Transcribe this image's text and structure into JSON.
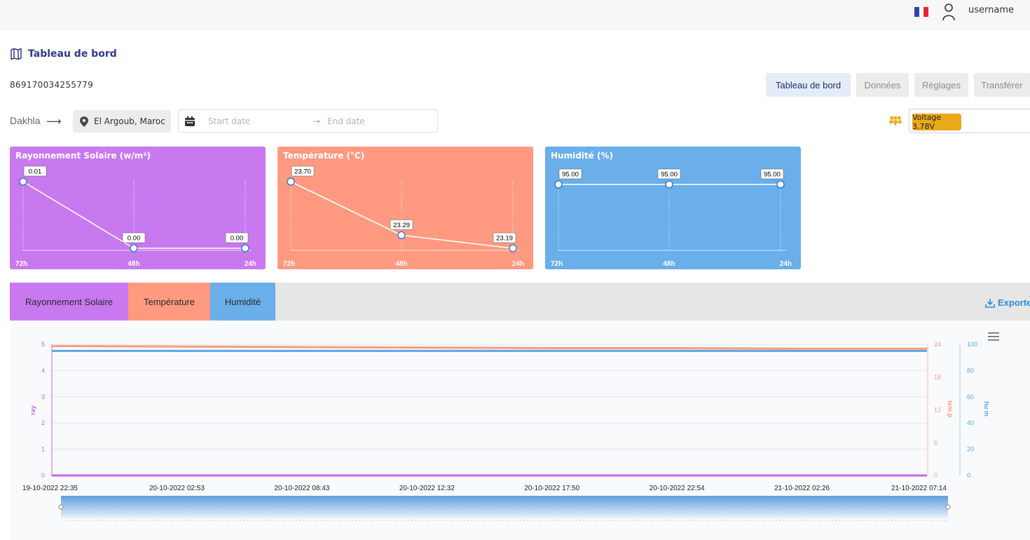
{
  "header": {
    "username": "username",
    "language_flag": "fr-flag-icon",
    "flag_colors": [
      "#2d46a8",
      "#ffffff",
      "#e32631"
    ]
  },
  "page": {
    "title": "Tableau de bord",
    "title_icon": "map-icon",
    "device_id": "869170034255779"
  },
  "nav_tabs": [
    {
      "label": "Tableau de bord",
      "active": true
    },
    {
      "label": "Données",
      "active": false
    },
    {
      "label": "Réglages",
      "active": false
    },
    {
      "label": "Transférer",
      "active": false
    }
  ],
  "location": {
    "from": "Dakhla",
    "arrow": "⟶",
    "to": "El Argoub, Maroc",
    "to_icon": "location-pin-icon"
  },
  "date_range": {
    "start_placeholder": "Start date",
    "separator": "→",
    "end_placeholder": "End date",
    "icon": "calendar-icon"
  },
  "voltage": {
    "icon": "solar-panel-icon",
    "label": "Voltage 3.78V",
    "badge_color": "#e9a91a"
  },
  "mini_cards": [
    {
      "title": "Rayonnement Solaire (w/m²)",
      "color": "#c879ef",
      "points": [
        {
          "label": "72h",
          "value": "0.01",
          "y": 0.01
        },
        {
          "label": "48h",
          "value": "0.00",
          "y": 0.0
        },
        {
          "label": "24h",
          "value": "0.00",
          "y": 0.0
        }
      ]
    },
    {
      "title": "Température (°C)",
      "color": "#ff9a80",
      "points": [
        {
          "label": "72h",
          "value": "23.70",
          "y": 23.7
        },
        {
          "label": "48h",
          "value": "23.29",
          "y": 23.29
        },
        {
          "label": "24h",
          "value": "23.19",
          "y": 23.19
        }
      ]
    },
    {
      "title": "Humidité (%)",
      "color": "#6aaeea",
      "points": [
        {
          "label": "72h",
          "value": "95.00",
          "y": 95.0
        },
        {
          "label": "48h",
          "value": "95.00",
          "y": 95.0
        },
        {
          "label": "24h",
          "value": "95.00",
          "y": 95.0
        }
      ]
    }
  ],
  "chart_tabs": [
    {
      "label": "Rayonnement Solaire",
      "color": "#c879ef"
    },
    {
      "label": "Température",
      "color": "#ff9a80"
    },
    {
      "label": "Humidité",
      "color": "#6aaeea"
    }
  ],
  "export": {
    "label": "Exporter",
    "icon": "download-icon"
  },
  "chart_data": {
    "type": "line",
    "x": [
      "19-10-2022 22:35",
      "20-10-2022 02:53",
      "20-10-2022 08:43",
      "20-10-2022 12:32",
      "20-10-2022 17:50",
      "20-10-2022 22:54",
      "21-10-2022 02:26",
      "21-10-2022 07:14"
    ],
    "series": [
      {
        "name": "ray",
        "axis": "left",
        "color": "#c466f0",
        "values": [
          0,
          0,
          0,
          0,
          0,
          0,
          0,
          0
        ]
      },
      {
        "name": "temp",
        "axis": "right1",
        "color": "#ff9a80",
        "values": [
          23.7,
          23.6,
          23.5,
          23.4,
          23.3,
          23.29,
          23.2,
          23.19
        ]
      },
      {
        "name": "hum",
        "axis": "right2",
        "color": "#5fa6e6",
        "values": [
          95,
          95,
          95,
          95,
          95,
          95,
          95,
          95
        ]
      }
    ],
    "axes": {
      "left": {
        "label": "ray",
        "ticks": [
          "0",
          "1",
          "2",
          "3",
          "4",
          "5"
        ],
        "range": [
          0,
          5
        ]
      },
      "right1": {
        "label": "tem p",
        "ticks": [
          "0",
          "6",
          "12",
          "18",
          "24"
        ],
        "range": [
          0,
          24
        ]
      },
      "right2": {
        "label": "hu m",
        "ticks": [
          "0",
          "20",
          "40",
          "60",
          "80",
          "100"
        ],
        "range": [
          0,
          100
        ]
      }
    },
    "grid": true,
    "menu_icon": "hamburger-menu-icon"
  }
}
